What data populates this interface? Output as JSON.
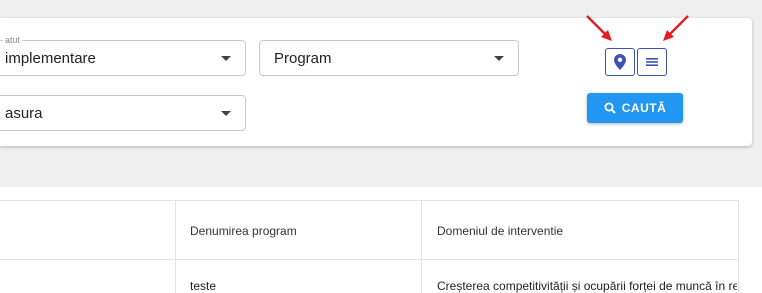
{
  "filters": {
    "status": {
      "legend": "atut",
      "value": "implementare"
    },
    "program": {
      "value": "Program"
    },
    "measure": {
      "value": "asura"
    }
  },
  "view_toggle": {
    "map_icon": "map-pin-icon",
    "list_icon": "list-icon"
  },
  "search_button": {
    "icon": "search-icon",
    "label": "CAUTĂ"
  },
  "colors": {
    "primary": "#2196f3",
    "outline": "#3f51b5",
    "annotation_arrow": "#e02020"
  },
  "table": {
    "columns": [
      "",
      "Denumirea program",
      "Domeniul de interventie"
    ],
    "rows": [
      [
        "",
        "teste",
        "Creșterea competitivității și ocupării forței de muncă în re"
      ]
    ]
  }
}
